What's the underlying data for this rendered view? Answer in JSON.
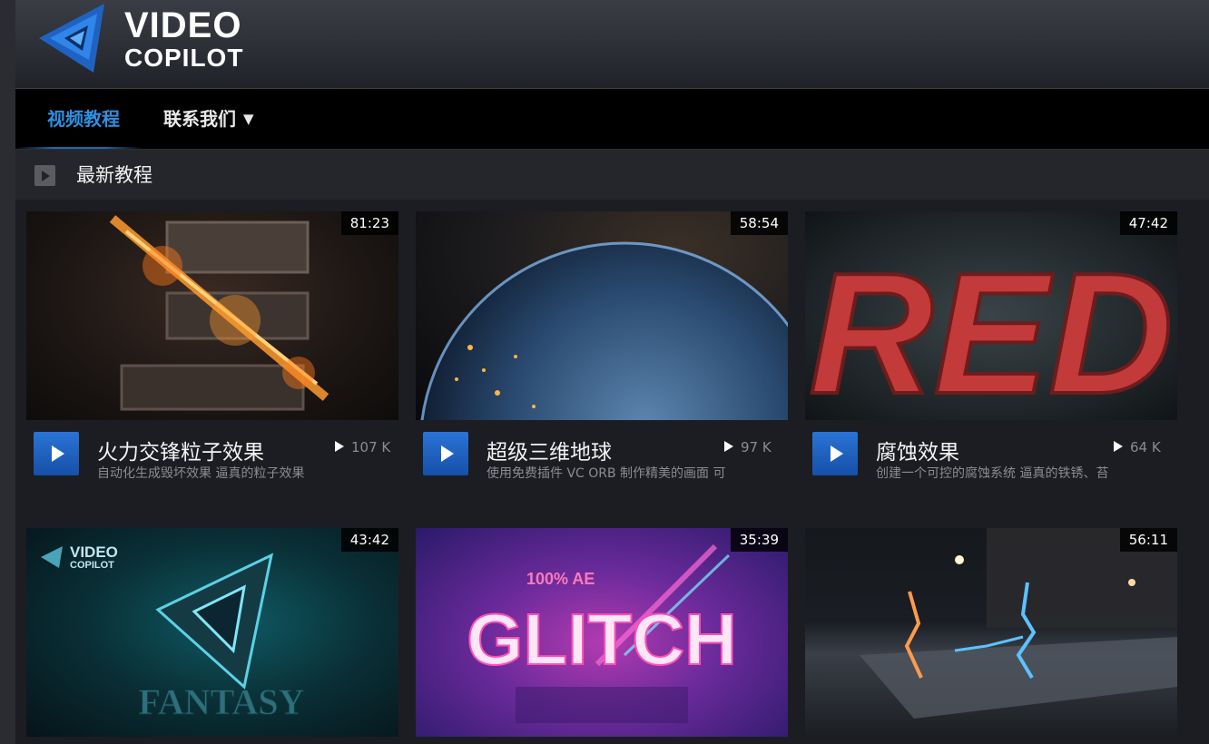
{
  "brand": {
    "line1": "VIDEO",
    "line2": "COPILOT"
  },
  "nav": {
    "items": [
      {
        "label": "视频教程",
        "active": true
      },
      {
        "label": "联系我们",
        "dropdown": true,
        "caret": "▼"
      }
    ]
  },
  "section": {
    "title": "最新教程"
  },
  "colors": {
    "accent": "#2f8fe0",
    "play_button": "#1e5fc0",
    "nav_bg": "#000000"
  },
  "videos": [
    {
      "duration": "81:23",
      "title": "火力交锋粒子效果",
      "views": "107 K",
      "desc": "自动化生成毁坏效果 逼真的粒子效果",
      "thumb": "fire-particles"
    },
    {
      "duration": "58:54",
      "title": "超级三维地球",
      "views": "97 K",
      "desc": "使用免费插件 VC ORB 制作精美的画面 可",
      "thumb": "earth-orb"
    },
    {
      "duration": "47:42",
      "title": "腐蚀效果",
      "views": "64 K",
      "desc": "创建一个可控的腐蚀系统 逼真的铁锈、苔",
      "thumb": "red-corrosion",
      "art_text": "RED"
    },
    {
      "duration": "43:42",
      "title": "",
      "views": "",
      "desc": "",
      "thumb": "fantasy",
      "art_text": "FANTASY",
      "art_brand1": "VIDEO",
      "art_brand2": "COPILOT"
    },
    {
      "duration": "35:39",
      "title": "",
      "views": "",
      "desc": "",
      "thumb": "glitch",
      "art_top": "100% AE",
      "art_text": "GLITCH"
    },
    {
      "duration": "56:11",
      "title": "",
      "views": "",
      "desc": "",
      "thumb": "lightning-street"
    }
  ]
}
